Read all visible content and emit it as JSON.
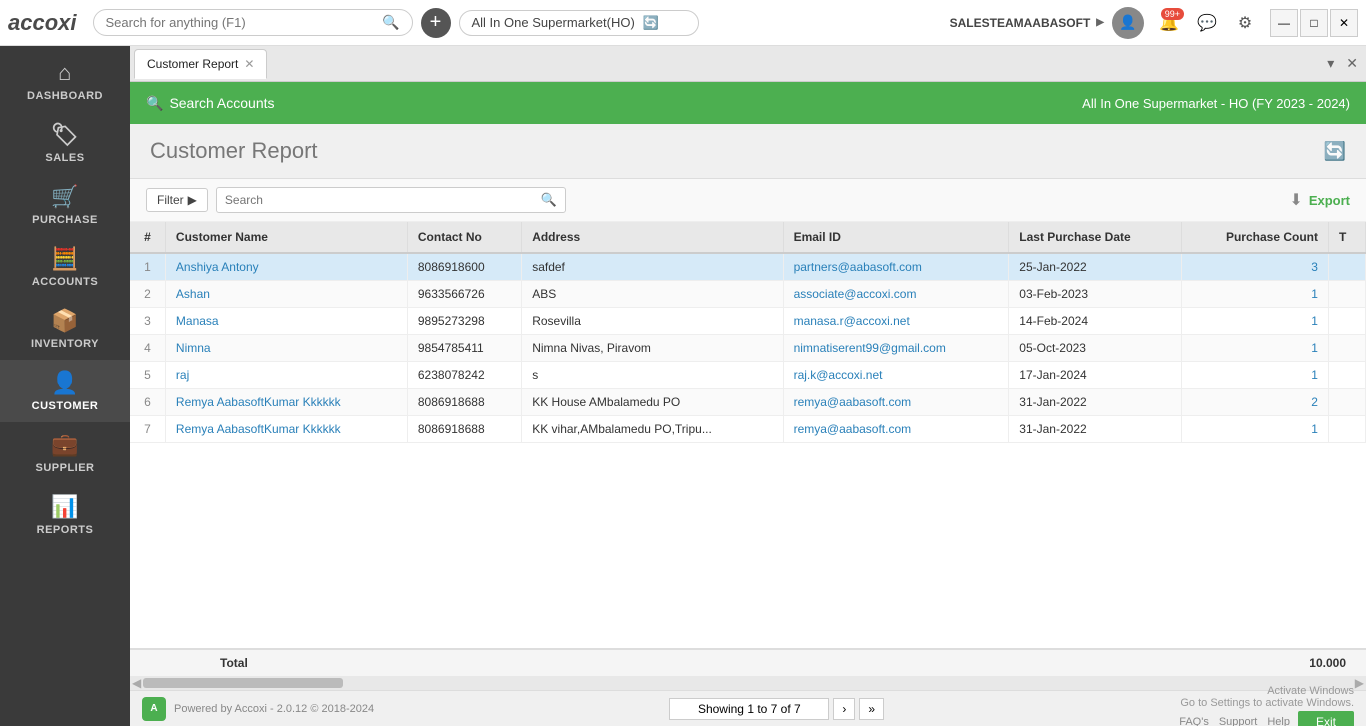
{
  "app": {
    "logo": "accoxi",
    "search_placeholder": "Search for anything (F1)"
  },
  "topbar": {
    "company": "All In One Supermarket(HO)",
    "user": "SALESTEAMAABASOFT",
    "notifications_count": "99+",
    "minimize_label": "—",
    "maximize_label": "□",
    "close_label": "✕"
  },
  "tab": {
    "label": "Customer Report",
    "close": "✕",
    "pin": "▾",
    "close_tab": "✕"
  },
  "green_header": {
    "search_accounts": "Search Accounts",
    "company_label": "All In One Supermarket - HO (FY 2023 - 2024)"
  },
  "page_header": {
    "title": "Customer Report"
  },
  "filter": {
    "label": "Filter",
    "expand": "▶",
    "search_placeholder": "Search",
    "export_label": "Export"
  },
  "table": {
    "columns": [
      "#",
      "Customer Name",
      "Contact No",
      "Address",
      "Email ID",
      "Last Purchase Date",
      "Purchase Count",
      "T"
    ],
    "rows": [
      {
        "num": 1,
        "name": "Anshiya Antony",
        "contact": "8086918600",
        "address": "safdef",
        "email": "partners@aabasoft.com",
        "last_purchase": "25-Jan-2022",
        "count": "3",
        "selected": true
      },
      {
        "num": 2,
        "name": "Ashan",
        "contact": "9633566726",
        "address": "ABS",
        "email": "associate@accoxi.com",
        "last_purchase": "03-Feb-2023",
        "count": "1",
        "selected": false
      },
      {
        "num": 3,
        "name": "Manasa",
        "contact": "9895273298",
        "address": "Rosevilla",
        "email": "manasa.r@accoxi.net",
        "last_purchase": "14-Feb-2024",
        "count": "1",
        "selected": false
      },
      {
        "num": 4,
        "name": "Nimna",
        "contact": "9854785411",
        "address": "Nimna Nivas, Piravom",
        "email": "nimnatiserent99@gmail.com",
        "last_purchase": "05-Oct-2023",
        "count": "1",
        "selected": false
      },
      {
        "num": 5,
        "name": "raj",
        "contact": "6238078242",
        "address": "s",
        "email": "raj.k@accoxi.net",
        "last_purchase": "17-Jan-2024",
        "count": "1",
        "selected": false
      },
      {
        "num": 6,
        "name": "Remya AabasoftKumar Kkkkkk",
        "contact": "8086918688",
        "address": "KK House AMbalamedu PO",
        "email": "remya@aabasoft.com",
        "last_purchase": "31-Jan-2022",
        "count": "2",
        "selected": false
      },
      {
        "num": 7,
        "name": "Remya AabasoftKumar Kkkkkk",
        "contact": "8086918688",
        "address": "KK vihar,AMbalamedu PO,Tripu...",
        "email": "remya@aabasoft.com",
        "last_purchase": "31-Jan-2022",
        "count": "1",
        "selected": false
      }
    ],
    "total_label": "Total",
    "total_count": "10.000"
  },
  "pagination": {
    "info": "Showing 1 to 7 of 7",
    "next": "›",
    "last": "»"
  },
  "bottom": {
    "powered": "Powered by Accoxi - 2.0.12 © 2018-2024",
    "activate_msg": "Activate Windows",
    "activate_sub": "Go to Settings to activate Windows.",
    "faq": "FAQ's",
    "support": "Support",
    "help": "Help",
    "exit": "Exit"
  },
  "sidebar": {
    "items": [
      {
        "id": "dashboard",
        "label": "DASHBOARD",
        "icon": "⌂"
      },
      {
        "id": "sales",
        "label": "SALES",
        "icon": "🏷",
        "has_expand": true
      },
      {
        "id": "purchase",
        "label": "PURCHASE",
        "icon": "🛒",
        "has_expand": true
      },
      {
        "id": "accounts",
        "label": "ACCOUNTS",
        "icon": "🧮",
        "has_expand": true
      },
      {
        "id": "inventory",
        "label": "INVENTORY",
        "icon": "📦",
        "has_expand": true
      },
      {
        "id": "customer",
        "label": "CUSTOMER",
        "icon": "👤"
      },
      {
        "id": "supplier",
        "label": "SUPPLIER",
        "icon": "💼"
      },
      {
        "id": "reports",
        "label": "REPORTS",
        "icon": "📊"
      }
    ]
  }
}
